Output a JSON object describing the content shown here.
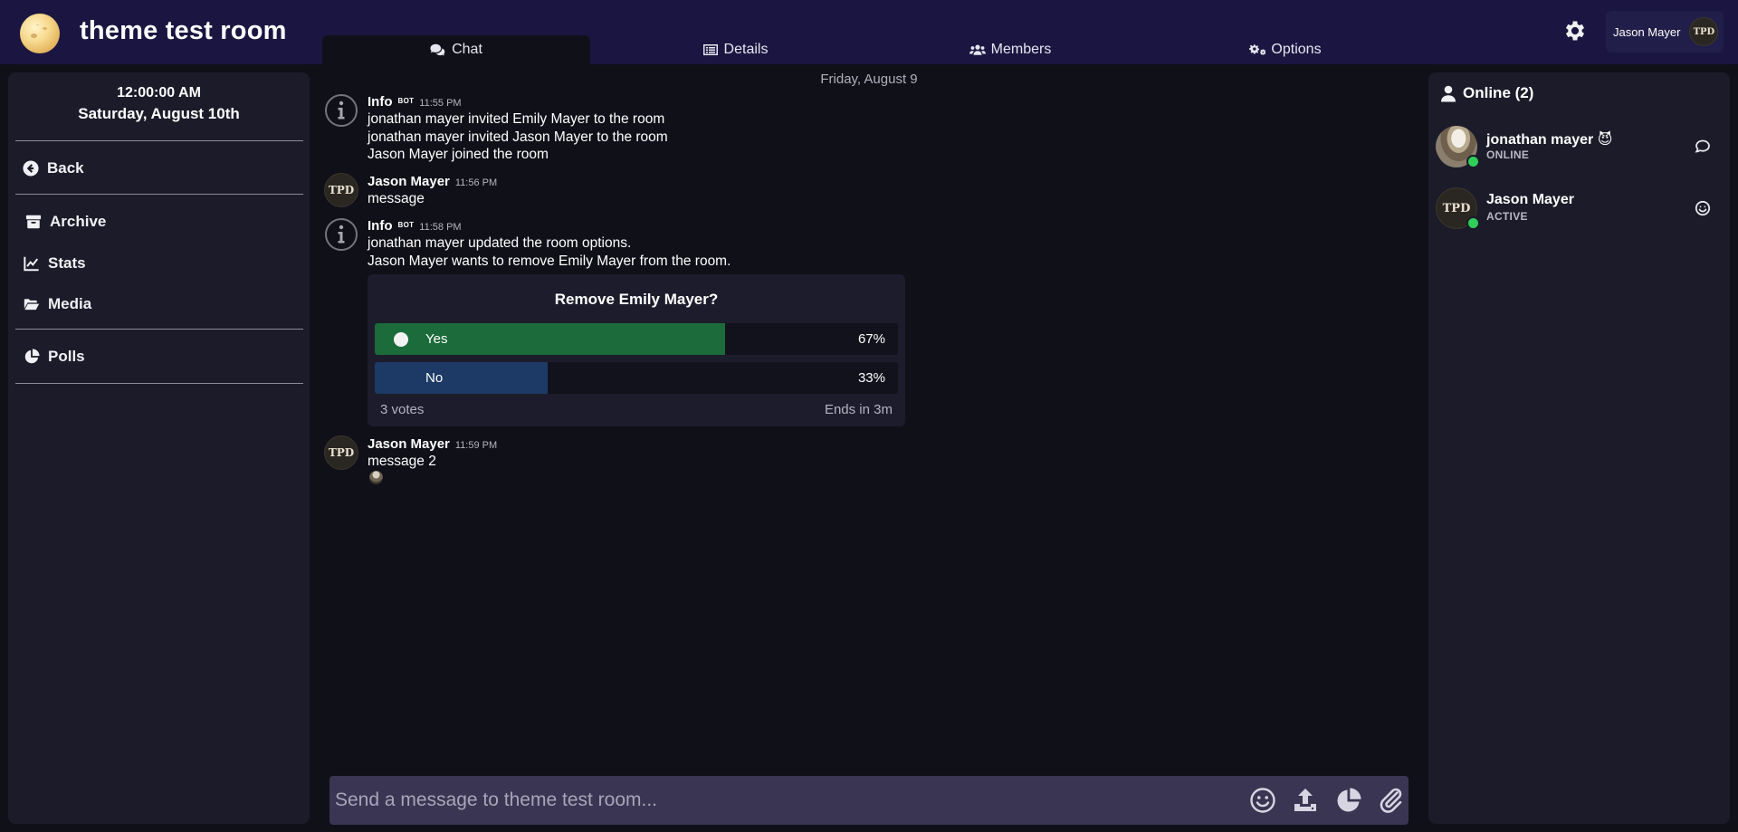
{
  "header": {
    "room_title": "theme test room",
    "user_name": "Jason Mayer",
    "avatar_initials": "TPD"
  },
  "tabs": [
    {
      "label": "Chat",
      "icon": "chat-icon",
      "active": true
    },
    {
      "label": "Details",
      "icon": "list-icon",
      "active": false
    },
    {
      "label": "Members",
      "icon": "users-icon",
      "active": false
    },
    {
      "label": "Options",
      "icon": "gears-icon",
      "active": false
    }
  ],
  "sidebar": {
    "time": "12:00:00 AM",
    "date": "Saturday, August 10th",
    "back_label": "Back",
    "items": [
      {
        "label": "Archive",
        "icon": "archive-icon"
      },
      {
        "label": "Stats",
        "icon": "chart-line-icon"
      },
      {
        "label": "Media",
        "icon": "folder-open-icon"
      },
      {
        "label": "Polls",
        "icon": "pie-chart-icon"
      }
    ]
  },
  "chat": {
    "date_separator": "Friday, August 9",
    "messages": [
      {
        "author": "Info",
        "bot_badge": "BOT",
        "time": "11:55 PM",
        "lines": [
          "jonathan mayer invited Emily Mayer to the room",
          "jonathan mayer invited Jason Mayer to the room",
          "Jason Mayer joined the room"
        ]
      },
      {
        "author": "Jason Mayer",
        "time": "11:56 PM",
        "lines": [
          "message"
        ]
      },
      {
        "author": "Info",
        "bot_badge": "BOT",
        "time": "11:58 PM",
        "lines": [
          "jonathan mayer updated the room options.",
          "Jason Mayer wants to remove Emily Mayer from the room."
        ]
      },
      {
        "author": "Jason Mayer",
        "time": "11:59 PM",
        "lines": [
          "message 2"
        ]
      }
    ],
    "poll": {
      "title": "Remove Emily Mayer?",
      "options": [
        {
          "label": "Yes",
          "percent": "67%",
          "fraction": 0.67,
          "color": "#1c6b3a",
          "selected": true
        },
        {
          "label": "No",
          "percent": "33%",
          "fraction": 0.33,
          "color": "#1d3a66",
          "selected": false
        }
      ],
      "votes": "3 votes",
      "ends": "Ends in 3m"
    }
  },
  "composer": {
    "placeholder": "Send a message to theme test room...",
    "icons": [
      "emoji-icon",
      "upload-icon",
      "poll-icon",
      "attach-icon"
    ]
  },
  "online": {
    "heading": "Online (2)",
    "members": [
      {
        "name": "jonathan mayer 😈",
        "status": "ONLINE",
        "action": "comment-icon"
      },
      {
        "name": "Jason Mayer",
        "status": "ACTIVE",
        "action": "smile-icon"
      }
    ]
  },
  "colors": {
    "topbar": "#1a1641",
    "background": "#101019",
    "panel": "#1b1b29",
    "presence": "#2fcf5a"
  }
}
